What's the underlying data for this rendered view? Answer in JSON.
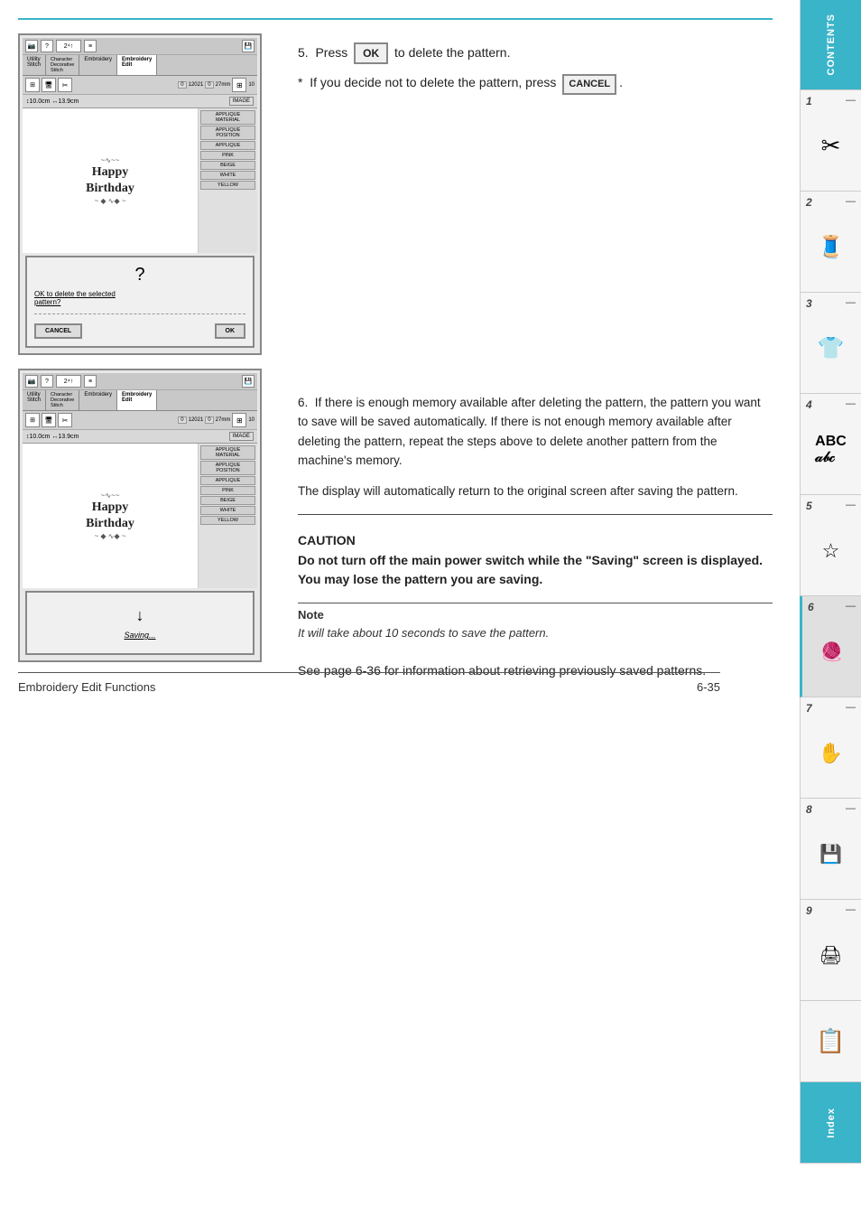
{
  "page": {
    "footer": {
      "title": "Embroidery Edit Functions",
      "page_number": "6-35"
    }
  },
  "sidebar": {
    "tabs": [
      {
        "id": "contents",
        "label": "CONTENTS",
        "type": "contents"
      },
      {
        "id": "1",
        "number": "1",
        "type": "numbered"
      },
      {
        "id": "2",
        "number": "2",
        "type": "numbered"
      },
      {
        "id": "3",
        "number": "3",
        "type": "numbered"
      },
      {
        "id": "4",
        "number": "4",
        "type": "numbered"
      },
      {
        "id": "5",
        "number": "5",
        "type": "numbered"
      },
      {
        "id": "6",
        "number": "6",
        "type": "numbered",
        "active": true
      },
      {
        "id": "7",
        "number": "7",
        "type": "numbered"
      },
      {
        "id": "8",
        "number": "8",
        "type": "numbered"
      },
      {
        "id": "9",
        "number": "9",
        "type": "numbered"
      },
      {
        "id": "notes",
        "type": "notes"
      },
      {
        "id": "index",
        "label": "Index",
        "type": "index"
      }
    ]
  },
  "screens": {
    "screen1": {
      "tabs": [
        "Utility\nStitch",
        "Character\nDecorative\nStitch",
        "Embroidery",
        "Embroidery\nEdit"
      ],
      "active_tab": "Embroidery\nEdit",
      "size_bar": "↕10.0cm ↔13.9cm",
      "image_label": "IMAGE",
      "canvas_content": "Happy\nBirthday",
      "sidebar_items": [
        "APPLIQUE\nMATERIAL",
        "APPLIQUE\nPOSITION",
        "APPLIQUE",
        "PINK",
        "BEIGE",
        "WHITE",
        "YELLOW"
      ],
      "dialog": {
        "icon": "?",
        "text": "OK to delete the selected pattern?",
        "buttons": [
          "CANCEL",
          "OK"
        ]
      }
    },
    "screen2": {
      "tabs": [
        "Utility\nStitch",
        "Character\nDecorative\nStitch",
        "Embroidery",
        "Embroidery\nEdit"
      ],
      "active_tab": "Embroidery\nEdit",
      "size_bar": "↕10.0cm ↔13.9cm",
      "image_label": "IMAGE",
      "canvas_content": "Happy\nBirthday",
      "sidebar_items": [
        "APPLIQUE\nMATERIAL",
        "APPLIQUE\nPOSITION",
        "APPLIQUE",
        "PINK",
        "BEIGE",
        "WHITE",
        "YELLOW"
      ],
      "saving": {
        "icon": "💾",
        "text": "Saving..."
      }
    }
  },
  "instructions": {
    "step5": {
      "number": "5.",
      "text": "Press",
      "ok_label": "OK",
      "action": "to delete the pattern."
    },
    "asterisk": {
      "text": "If you decide not to delete the pattern, press",
      "cancel_label": "CANCEL",
      "end": "."
    },
    "step6": {
      "number": "6.",
      "text": "If there is enough memory available after deleting the pattern, the pattern you want to save will be saved automatically. If there is not enough memory available after deleting the pattern, repeat the steps above to delete another pattern from the machine's memory."
    },
    "display_note": "The display will automatically return to the original screen after saving the pattern.",
    "caution": {
      "title": "CAUTION",
      "text": "Do not turn off the main power switch while the \"Saving\" screen is displayed. You may lose the pattern you are saving."
    },
    "note": {
      "title": "Note",
      "text": "It will take about 10 seconds to save the pattern."
    },
    "see_page": "See page 6-36 for information about retrieving previously saved patterns."
  }
}
